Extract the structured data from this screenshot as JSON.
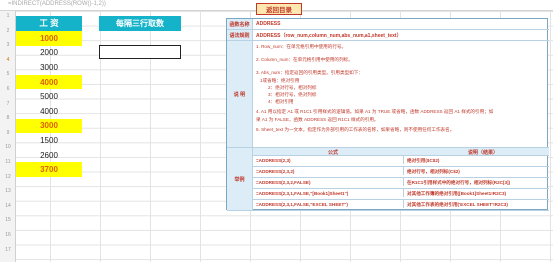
{
  "formula_bar": {
    "text": "=INDIRECT(ADDRESS(ROW()-1,2))"
  },
  "back_button": {
    "label": "返回目录"
  },
  "left_table": {
    "header_1": "工 资",
    "header_2": "每隔三行取数",
    "rows": [
      {
        "value": "1000",
        "highlight": true
      },
      {
        "value": "2000",
        "highlight": false
      },
      {
        "value": "3000",
        "highlight": false
      },
      {
        "value": "4000",
        "highlight": true
      },
      {
        "value": "5000",
        "highlight": false
      },
      {
        "value": "4000",
        "highlight": false
      },
      {
        "value": "3000",
        "highlight": true
      },
      {
        "value": "1500",
        "highlight": false
      },
      {
        "value": "2600",
        "highlight": false
      },
      {
        "value": "3700",
        "highlight": true
      }
    ]
  },
  "row_numbers": [
    "1",
    "2",
    "3",
    "4",
    "5",
    "6",
    "7",
    "8",
    "9",
    "10",
    "11",
    "12",
    "13",
    "14",
    "15",
    "16",
    "17"
  ],
  "panel": {
    "name_label": "函数名称",
    "name_value": "ADDRESS",
    "syntax_label": "语法规则",
    "syntax_value": "ADDRESS（row_num,column_num,abs_num,a1,sheet_text）",
    "desc_label": "说 明",
    "desc": {
      "l1": "1. Row_num：在单元格引用中使用的行号。",
      "l2": "2. Column_num：在单元格引用中使用的列标。",
      "l3": "3. Abs_num：指定返回的引用类型。引用类型如下：",
      "l3a": "1或省略：绝对引用",
      "l3b": "2：绝对行号，相对列标",
      "l3c": "3：相对行号，绝对列标",
      "l3d": "4：相对引用",
      "l4a": "4. A1 用以指定 A1 或 R1C1 引用样式的逻辑值。如果 A1 为 TRUE 或省略，函数 ADDRESS 返回 A1 样式的引用；如",
      "l4b": "果 A1 为 FALSE，函数 ADDRESS 返回 R1C1 样式的引用。",
      "l5": "5. Sheet_text 为一文本，指定作为外部引用的工作表的名称，如果省略，则不使用任何工作表名。"
    },
    "example_label": "举例",
    "example_head_formula": "公式",
    "example_head_result": "说明（结果）",
    "examples": [
      {
        "formula": "=ADDRESS(2,3)",
        "result": "绝对引用($C$2)"
      },
      {
        "formula": "=ADDRESS(2,3,2)",
        "result": "绝对行号，相对列标(C$2)"
      },
      {
        "formula": "=ADDRESS(2,3,2,FALSE)",
        "result": "在R1C1引用样式中的绝对行号，相对列标(R2C[3])"
      },
      {
        "formula": "=ADDRESS(2,3,1,FALSE,\"[Book1]Sheet1\")",
        "result": "对其他工作簿的绝对引用([Book1]Sheet1!R2C3)"
      },
      {
        "formula": "=ADDRESS(2,3,1,FALSE,\"EXCEL SHEET\")",
        "result": "对其他工作表的绝对引用('EXCEL SHEET'!R2C3)"
      }
    ]
  },
  "colors": {
    "header_bg": "#14b3c9",
    "highlight_bg": "#ffff00",
    "highlight_text": "#e06000",
    "accent_red": "#c0392b"
  }
}
